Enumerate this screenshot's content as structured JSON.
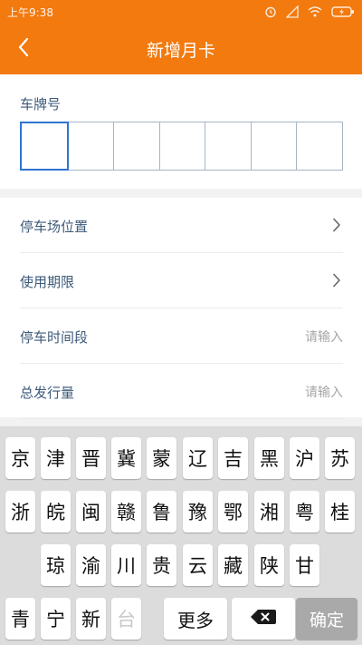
{
  "status_bar": {
    "time": "上午9:38"
  },
  "nav": {
    "title": "新增月卡"
  },
  "plate": {
    "label": "车牌号",
    "cells": 7,
    "active_index": 0
  },
  "form": {
    "rows": [
      {
        "label": "停车场位置",
        "type": "select"
      },
      {
        "label": "使用期限",
        "type": "select"
      },
      {
        "label": "停车时间段",
        "type": "input",
        "placeholder": "请输入"
      },
      {
        "label": "总发行量",
        "type": "input",
        "placeholder": "请输入"
      }
    ]
  },
  "keyboard": {
    "row1": [
      "京",
      "津",
      "晋",
      "冀",
      "蒙",
      "辽",
      "吉",
      "黑",
      "沪",
      "苏"
    ],
    "row2": [
      "浙",
      "皖",
      "闽",
      "赣",
      "鲁",
      "豫",
      "鄂",
      "湘",
      "粤",
      "桂"
    ],
    "row3": [
      "琼",
      "渝",
      "川",
      "贵",
      "云",
      "藏",
      "陕",
      "甘"
    ],
    "row4": [
      "青",
      "宁",
      "新",
      "台"
    ],
    "row4_disabled": [
      "台"
    ],
    "more_label": "更多",
    "confirm_label": "确定"
  },
  "colors": {
    "brand": "#f27a0f",
    "active_border": "#2f74d0",
    "label": "#3e5a7a"
  },
  "icons": {
    "back": "chevron-left-icon",
    "chevron": "chevron-right-icon",
    "backspace": "backspace-icon"
  }
}
